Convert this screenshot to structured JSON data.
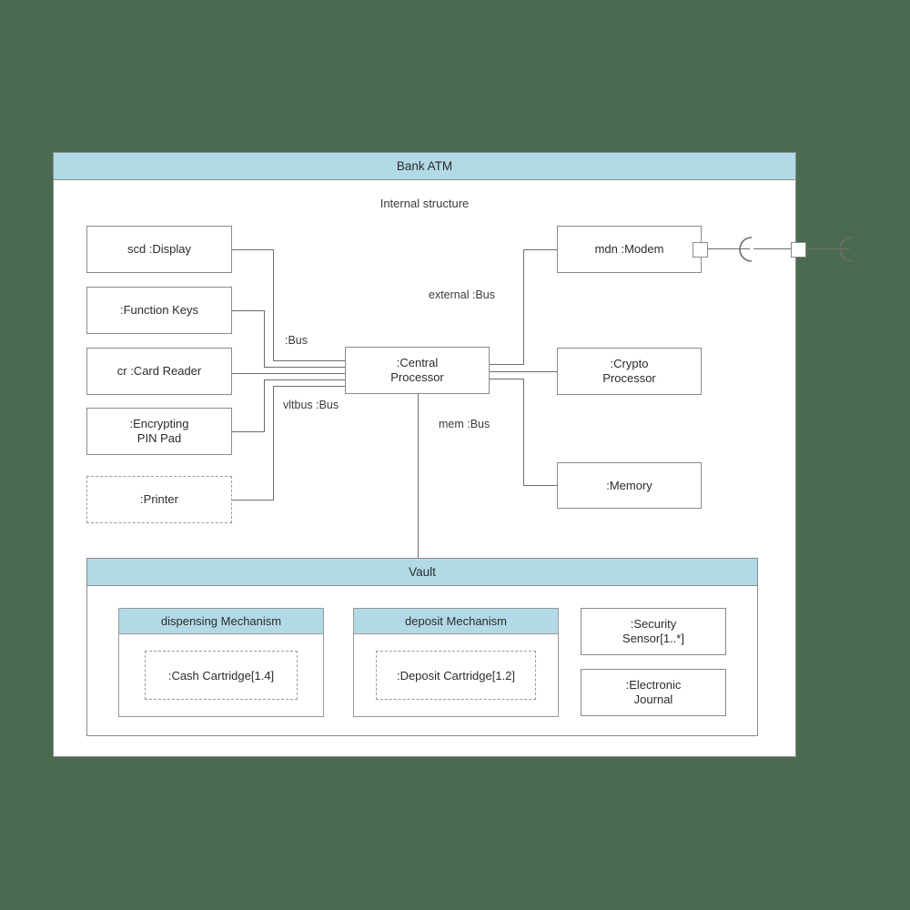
{
  "diagram": {
    "title": "Bank ATM",
    "subtitle": "Internal structure",
    "background_color": "#4a6b4f",
    "frame_fill": "#ffffff",
    "header_fill": "#b2dae6",
    "border_color": "#8a8a8a",
    "line_color": "#6d6d6d"
  },
  "parts": {
    "display": "scd :Display",
    "function_keys": ":Function Keys",
    "card_reader": "cr :Card Reader",
    "encrypting_pin_pad": ":Encrypting\nPIN Pad",
    "encrypting_pin_pad_line1": ":Encrypting",
    "encrypting_pin_pad_line2": "PIN Pad",
    "printer": ":Printer",
    "central_processor_line1": ":Central",
    "central_processor_line2": "Processor",
    "modem": "mdn :Modem",
    "crypto_processor_line1": ":Crypto",
    "crypto_processor_line2": "Processor",
    "memory": ":Memory"
  },
  "connectors": {
    "bus": ":Bus",
    "vltbus": "vltbus :Bus",
    "external": "external :Bus",
    "mem": "mem :Bus"
  },
  "vault": {
    "title": "Vault",
    "dispensing_mechanism": "dispensing Mechanism",
    "deposit_mechanism": "deposit Mechanism",
    "cash_cartridge": ":Cash Cartridge[1.4]",
    "deposit_cartridge": ":Deposit Cartridge[1.2]",
    "security_sensor_line1": ":Security",
    "security_sensor_line2": "Sensor[1..*]",
    "electronic_journal_line1": ":Electronic",
    "electronic_journal_line2": "Journal"
  }
}
